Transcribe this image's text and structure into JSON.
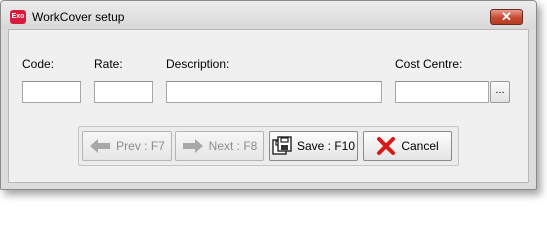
{
  "window": {
    "title": "WorkCover setup",
    "app_icon_text": "Exo",
    "close_glyph": "✕"
  },
  "form": {
    "code": {
      "label": "Code:",
      "value": ""
    },
    "rate": {
      "label": "Rate:",
      "value": ""
    },
    "description": {
      "label": "Description:",
      "value": ""
    },
    "cost_centre": {
      "label": "Cost Centre:",
      "value": "",
      "lookup_label": "..."
    }
  },
  "buttons": {
    "prev": {
      "label": "Prev : F7",
      "icon": "arrow-left-icon",
      "enabled": false
    },
    "next": {
      "label": "Next : F8",
      "icon": "arrow-right-icon",
      "enabled": false
    },
    "save": {
      "label": "Save : F10",
      "icon": "save-icon",
      "enabled": true
    },
    "cancel": {
      "label": "Cancel",
      "icon": "cancel-x-icon",
      "enabled": true
    }
  },
  "colors": {
    "cancel_icon": "#d91a1a",
    "disabled_icon": "#a8a8a8",
    "app_icon": "#d81b3c"
  }
}
